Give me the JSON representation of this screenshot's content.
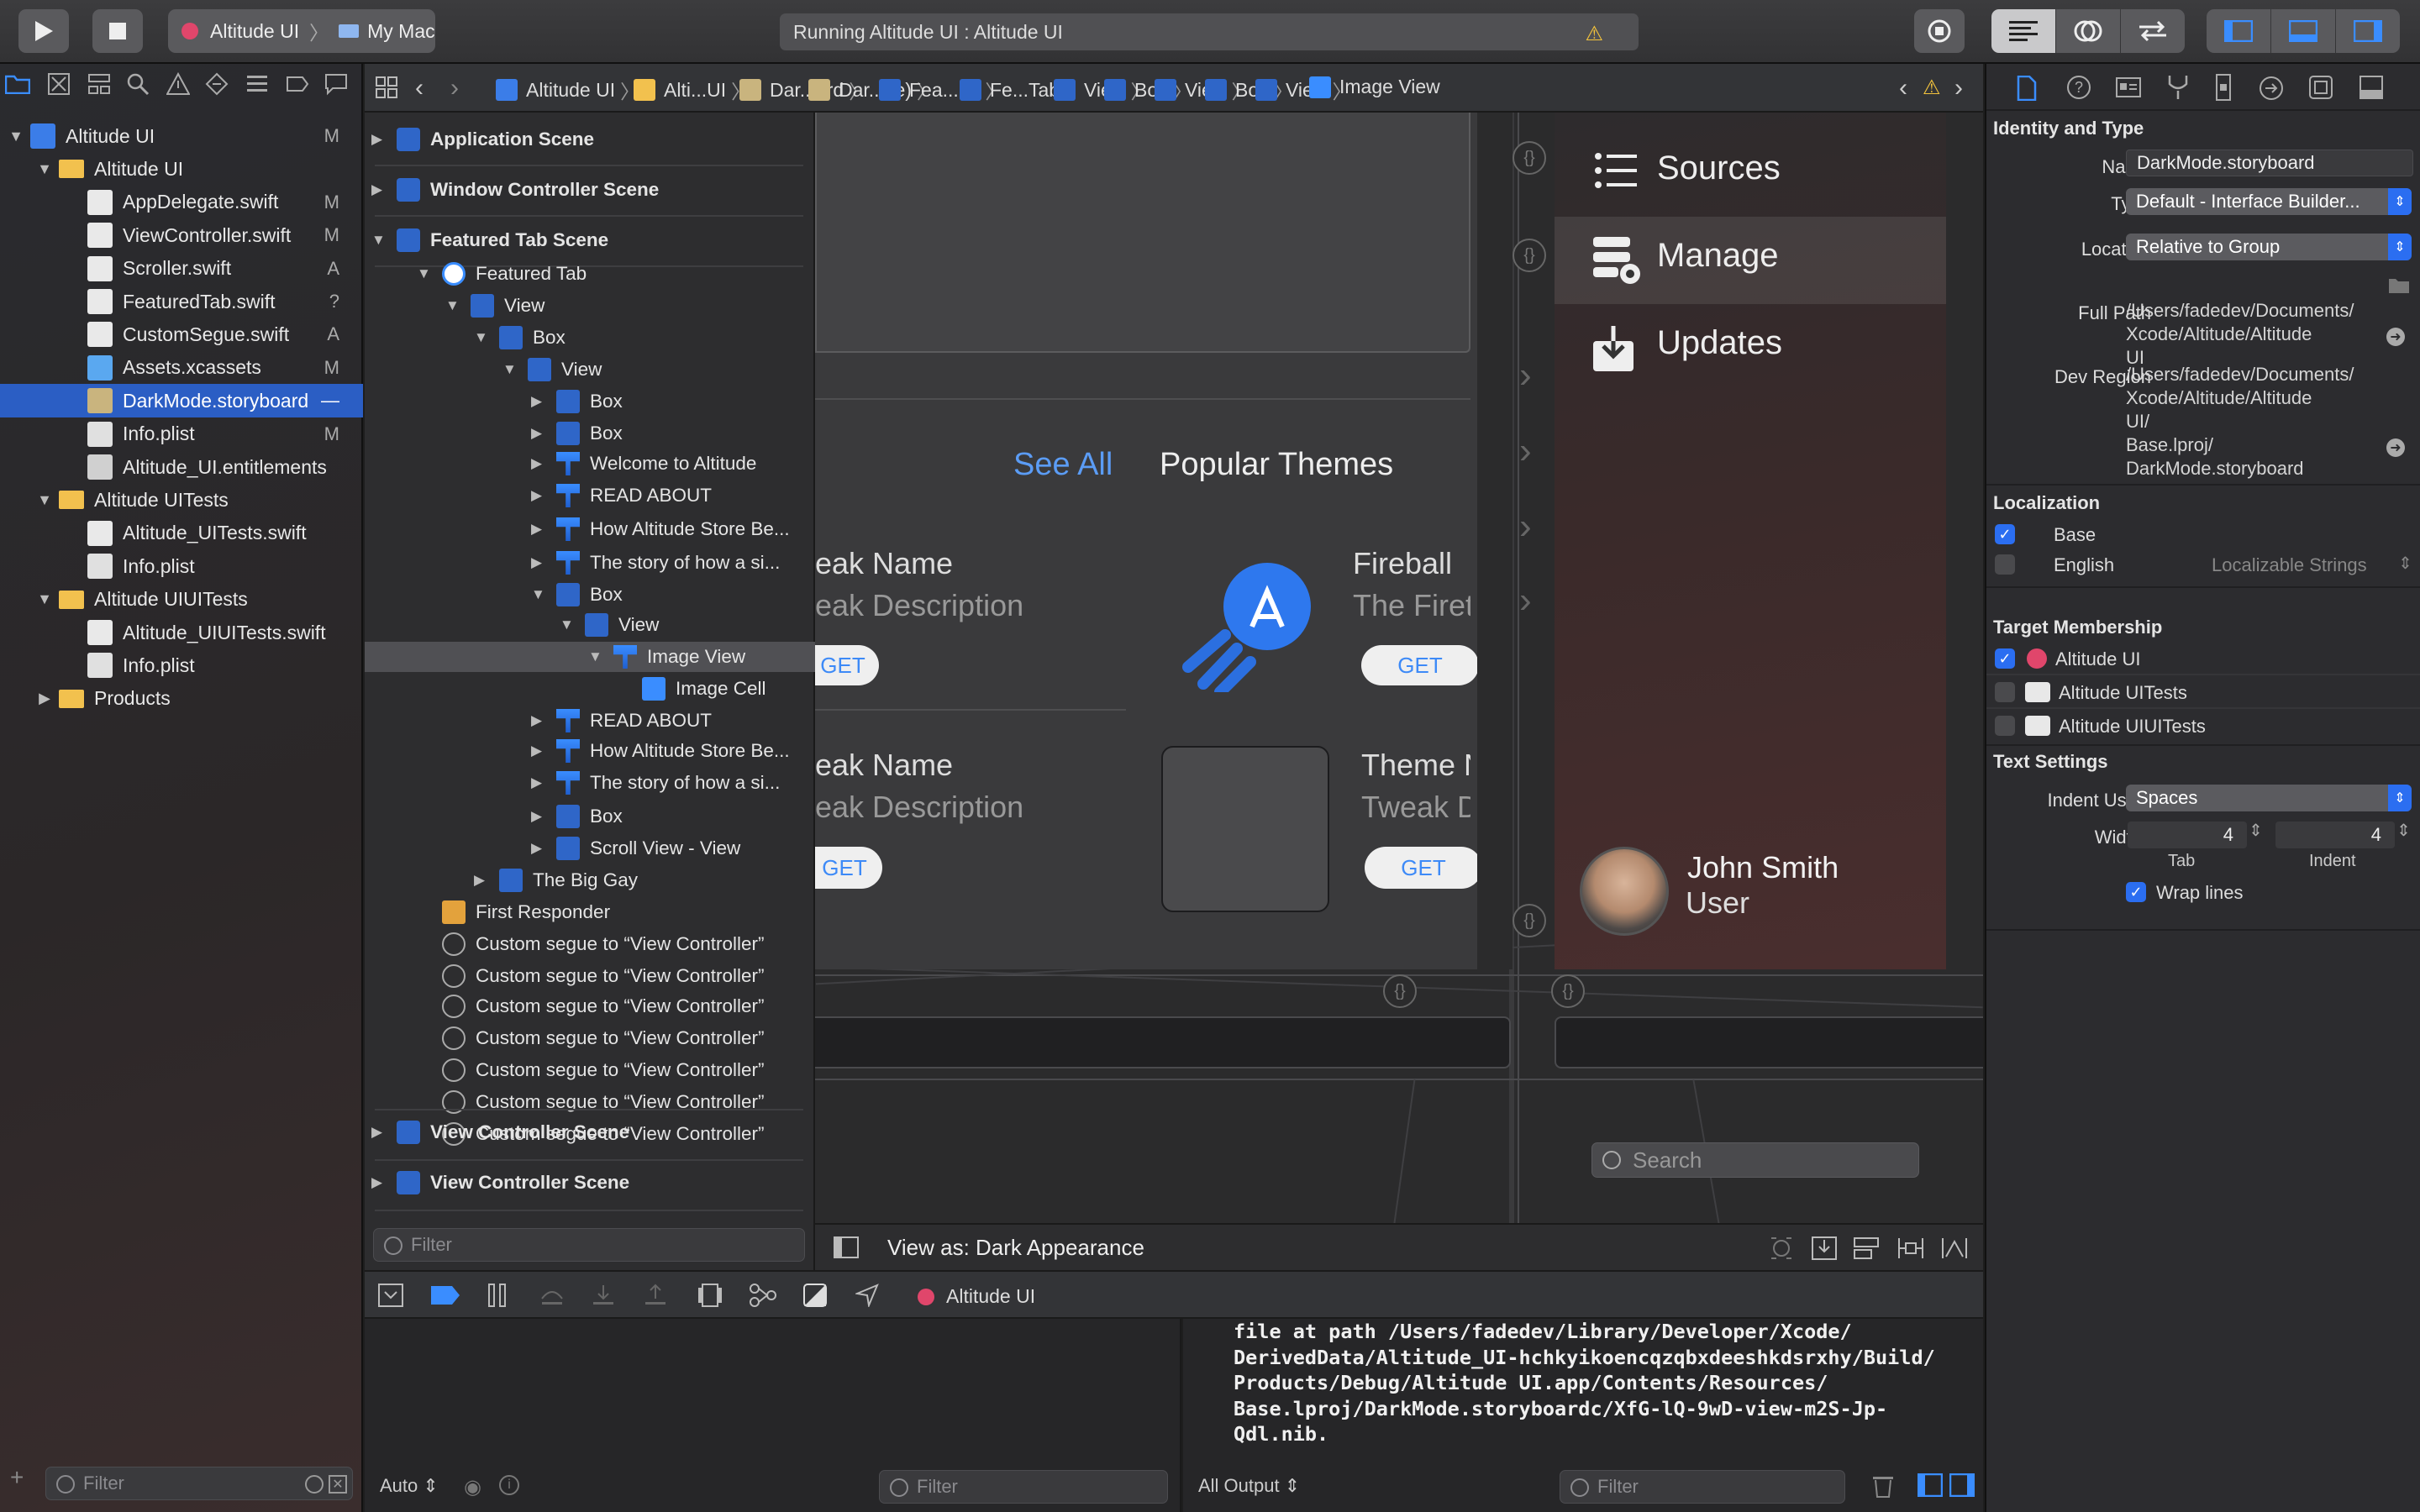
{
  "toolbar": {
    "scheme": "Altitude UI",
    "destination": "My Mac",
    "activity": "Running Altitude UI : Altitude UI"
  },
  "navigator": {
    "items": [
      {
        "label": "Altitude UI",
        "status": "M",
        "level": 0,
        "type": "project",
        "open": true
      },
      {
        "label": "Altitude UI",
        "status": "",
        "level": 1,
        "type": "folder",
        "open": true
      },
      {
        "label": "AppDelegate.swift",
        "status": "M",
        "level": 2,
        "type": "swift"
      },
      {
        "label": "ViewController.swift",
        "status": "M",
        "level": 2,
        "type": "swift"
      },
      {
        "label": "Scroller.swift",
        "status": "A",
        "level": 2,
        "type": "swift"
      },
      {
        "label": "FeaturedTab.swift",
        "status": "?",
        "level": 2,
        "type": "swift"
      },
      {
        "label": "CustomSegue.swift",
        "status": "A",
        "level": 2,
        "type": "swift"
      },
      {
        "label": "Assets.xcassets",
        "status": "M",
        "level": 2,
        "type": "assets"
      },
      {
        "label": "DarkMode.storyboard",
        "status": "—",
        "level": 2,
        "type": "storyboard",
        "active": true
      },
      {
        "label": "Info.plist",
        "status": "M",
        "level": 2,
        "type": "plist"
      },
      {
        "label": "Altitude_UI.entitlements",
        "status": "",
        "level": 2,
        "type": "ent"
      },
      {
        "label": "Altitude UITests",
        "status": "",
        "level": 1,
        "type": "folder",
        "open": true
      },
      {
        "label": "Altitude_UITests.swift",
        "status": "",
        "level": 2,
        "type": "swift"
      },
      {
        "label": "Info.plist",
        "status": "",
        "level": 2,
        "type": "plist"
      },
      {
        "label": "Altitude UIUITests",
        "status": "",
        "level": 1,
        "type": "folder",
        "open": true
      },
      {
        "label": "Altitude_UIUITests.swift",
        "status": "",
        "level": 2,
        "type": "swift"
      },
      {
        "label": "Info.plist",
        "status": "",
        "level": 2,
        "type": "plist"
      },
      {
        "label": "Products",
        "status": "",
        "level": 1,
        "type": "folder",
        "open": false
      }
    ],
    "filter_placeholder": "Filter"
  },
  "jumpbar": {
    "crumbs": [
      "Altitude UI",
      "Alti...UI",
      "Dar...ard",
      "Dar...se)",
      "Fea...ne",
      "Fe...Tab",
      "View",
      "Box",
      "View",
      "Box",
      "View",
      "Image View"
    ]
  },
  "outline": {
    "rows": [
      {
        "label": "Application Scene",
        "lvl": 0,
        "disc": "closed",
        "icon": "scene",
        "scene": true
      },
      {
        "label": "Window Controller Scene",
        "lvl": 0,
        "disc": "closed",
        "icon": "scene",
        "scene": true
      },
      {
        "label": "Featured Tab Scene",
        "lvl": 0,
        "disc": "open",
        "icon": "scene",
        "scene": true
      },
      {
        "label": "Featured Tab",
        "lvl": 1,
        "disc": "open",
        "icon": "vc"
      },
      {
        "label": "View",
        "lvl": 2,
        "disc": "open",
        "icon": "box"
      },
      {
        "label": "Box",
        "lvl": 3,
        "disc": "open",
        "icon": "box"
      },
      {
        "label": "View",
        "lvl": 4,
        "disc": "open",
        "icon": "box"
      },
      {
        "label": "Box",
        "lvl": 5,
        "disc": "closed",
        "icon": "box"
      },
      {
        "label": "Box",
        "lvl": 5,
        "disc": "closed",
        "icon": "box"
      },
      {
        "label": "Welcome to Altitude",
        "lvl": 5,
        "disc": "closed",
        "icon": "text"
      },
      {
        "label": "READ ABOUT",
        "lvl": 5,
        "disc": "closed",
        "icon": "text"
      },
      {
        "label": "How Altitude Store Be...",
        "lvl": 5,
        "disc": "closed",
        "icon": "text"
      },
      {
        "label": "The story of how a si...",
        "lvl": 5,
        "disc": "closed",
        "icon": "text"
      },
      {
        "label": "Box",
        "lvl": 5,
        "disc": "open",
        "icon": "box"
      },
      {
        "label": "View",
        "lvl": 6,
        "disc": "open",
        "icon": "box"
      },
      {
        "label": "Image View",
        "lvl": 7,
        "disc": "open",
        "icon": "text",
        "selected": true
      },
      {
        "label": "Image Cell",
        "lvl": 8,
        "disc": "",
        "icon": "cell"
      },
      {
        "label": "READ ABOUT",
        "lvl": 5,
        "disc": "closed",
        "icon": "text"
      },
      {
        "label": "How Altitude Store Be...",
        "lvl": 5,
        "disc": "closed",
        "icon": "text"
      },
      {
        "label": "The story of how a si...",
        "lvl": 5,
        "disc": "closed",
        "icon": "text"
      },
      {
        "label": "Box",
        "lvl": 5,
        "disc": "closed",
        "icon": "box"
      },
      {
        "label": "Scroll View - View",
        "lvl": 5,
        "disc": "closed",
        "icon": "box"
      },
      {
        "label": "The Big Gay",
        "lvl": 3,
        "disc": "closed",
        "icon": "box"
      },
      {
        "label": "First Responder",
        "lvl": 1,
        "disc": "",
        "icon": "cube"
      },
      {
        "label": "Custom segue to “View Controller”",
        "lvl": 1,
        "disc": "",
        "icon": "segue"
      },
      {
        "label": "Custom segue to “View Controller”",
        "lvl": 1,
        "disc": "",
        "icon": "segue"
      },
      {
        "label": "Custom segue to “View Controller”",
        "lvl": 1,
        "disc": "",
        "icon": "segue"
      },
      {
        "label": "Custom segue to “View Controller”",
        "lvl": 1,
        "disc": "",
        "icon": "segue"
      },
      {
        "label": "Custom segue to “View Controller”",
        "lvl": 1,
        "disc": "",
        "icon": "segue"
      },
      {
        "label": "Custom segue to “View Controller”",
        "lvl": 1,
        "disc": "",
        "icon": "segue"
      },
      {
        "label": "Custom segue to “View Controller”",
        "lvl": 1,
        "disc": "",
        "icon": "segue"
      }
    ],
    "bottom_scenes": [
      "View Controller Scene",
      "View Controller Scene"
    ],
    "filter_placeholder": "Filter"
  },
  "canvas": {
    "see_all": "See All",
    "popular_themes": "Popular Themes",
    "card1_name": "eak Name",
    "card1_desc": "eak Description",
    "card1_btn": "GET",
    "card2_name": "Fireball",
    "card2_desc": "The Firet",
    "card2_btn": "GET",
    "card3_name": "eak Name",
    "card3_desc": "eak Description",
    "card3_btn": "GET",
    "card4_name": "Theme N",
    "card4_desc": "Tweak D",
    "card4_btn": "GET",
    "menu": [
      "Sources",
      "Manage",
      "Updates"
    ],
    "user_name": "John Smith",
    "user_role": "User",
    "search_placeholder": "Search",
    "view_as": "View as: Dark Appearance"
  },
  "inspector": {
    "identity_title": "Identity and Type",
    "name_label": "Name",
    "name_value": "DarkMode.storyboard",
    "type_label": "Type",
    "type_value": "Default - Interface Builder...",
    "location_label": "Location",
    "location_value": "Relative to Group",
    "fullpath_label": "Full Path",
    "fullpath_value": "/Users/fadedev/Documents/ Xcode/Altitude/Altitude UI",
    "devregion_label": "Dev Region",
    "devregion_value": "/Users/fadedev/Documents/ Xcode/Altitude/Altitude UI/ Base.lproj/ DarkMode.storyboard",
    "localization_title": "Localization",
    "loc_base": "Base",
    "loc_english": "English",
    "loc_english_type": "Localizable Strings",
    "target_title": "Target Membership",
    "targets": [
      "Altitude UI",
      "Altitude UITests",
      "Altitude UIUITests"
    ],
    "text_title": "Text Settings",
    "indent_label": "Indent Using",
    "indent_value": "Spaces",
    "widths_label": "Widths",
    "tab_value": "4",
    "indent_num": "4",
    "tab_caption": "Tab",
    "indent_caption": "Indent",
    "wrap_label": "Wrap lines"
  },
  "debug": {
    "target": "Altitude UI",
    "auto_label": "Auto",
    "console_lines": [
      "file at path /Users/fadedev/Library/Developer/Xcode/",
      "DerivedData/Altitude_UI-hchkyikoencqzqbxdeeshkdsrxhy/Build/",
      "Products/Debug/Altitude UI.app/Contents/Resources/",
      "Base.lproj/DarkMode.storyboardc/XfG-lQ-9wD-view-m2S-Jp-",
      "Qdl.nib."
    ],
    "output_label": "All Output",
    "filter_placeholder": "Filter"
  }
}
